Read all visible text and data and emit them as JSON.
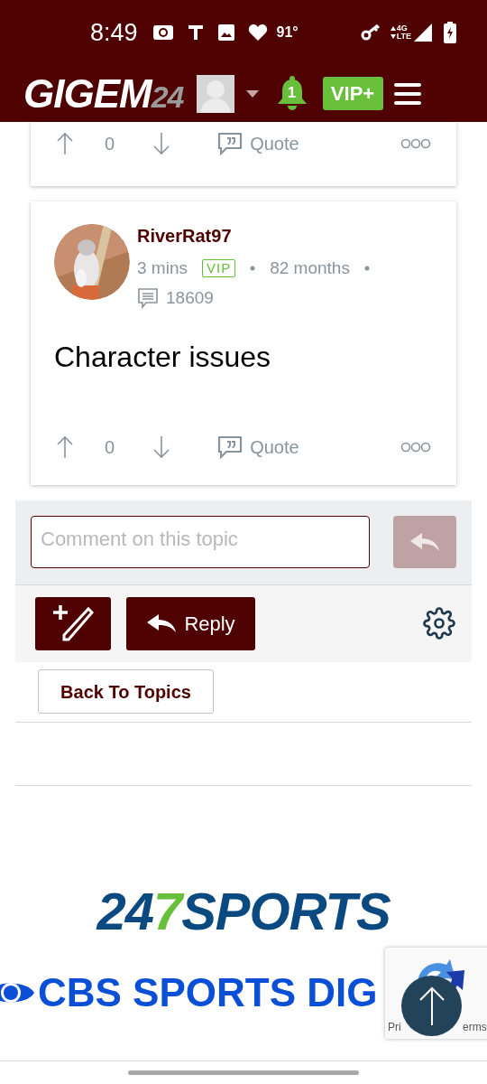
{
  "status_bar": {
    "time": "8:49",
    "temperature": "91°",
    "network": [
      "4G",
      "LTE"
    ]
  },
  "header": {
    "logo": [
      "GIGEM",
      "24"
    ],
    "notification_count": "1",
    "vip_button": "VIP+"
  },
  "posts": [
    {
      "kind": "partial",
      "votes": "0",
      "quote": "Quote"
    },
    {
      "kind": "full",
      "author": "RiverRat97",
      "time": "3 mins",
      "badge": "VIP",
      "tenure": "82 months",
      "post_count": "18609",
      "body": "Character issues",
      "votes": "0",
      "quote": "Quote"
    }
  ],
  "comment_box": {
    "placeholder": "Comment on this topic"
  },
  "actions": {
    "reply": "Reply",
    "back": "Back To Topics"
  },
  "footer": {
    "logos": [
      "247",
      "SPORTS",
      "CBS SPORTS DIG"
    ]
  },
  "recaptcha": {
    "texts": [
      "Pri",
      "erms"
    ]
  }
}
